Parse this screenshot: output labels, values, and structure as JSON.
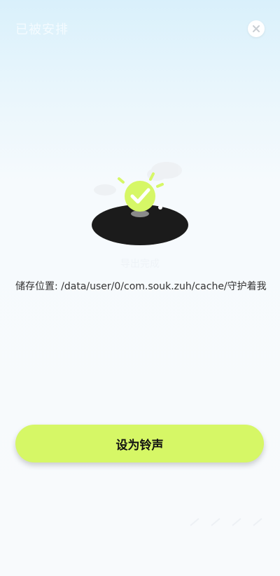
{
  "header": {
    "title": "已被安排"
  },
  "result": {
    "status": "导出完成",
    "storage_label": "储存位置",
    "storage_sep": ": ",
    "storage_path": "/data/user/0/com.souk.zuh/cache/守护着我…"
  },
  "actions": {
    "set_ringtone": "设为铃声"
  },
  "icons": {
    "close": "close-icon",
    "success": "check-icon"
  },
  "colors": {
    "accent": "#d6f766",
    "record": "#1b1b1b",
    "text": "#333333"
  }
}
